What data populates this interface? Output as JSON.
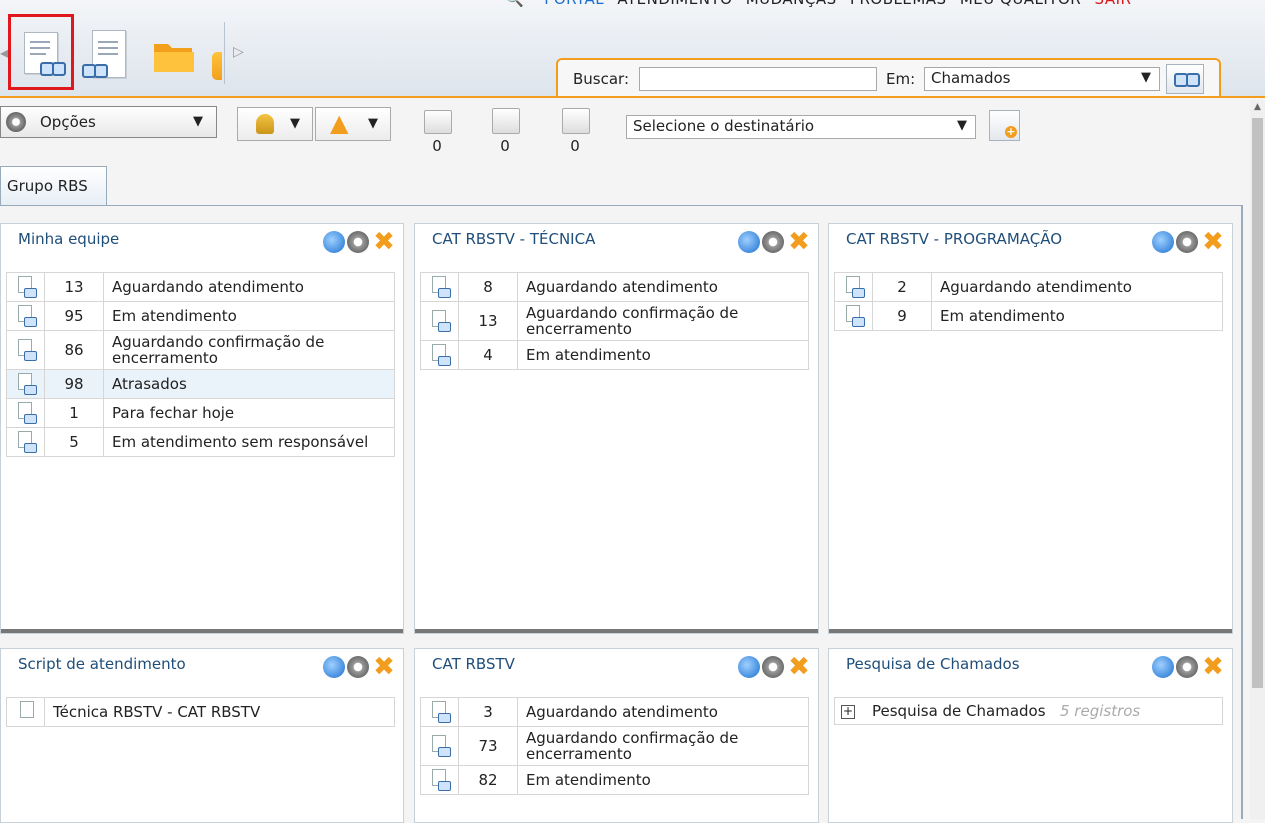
{
  "top_nav": {
    "portal": "PORTAL",
    "atendimento": "ATENDIMENTO",
    "mudancas": "MUDANÇAS",
    "problemas": "PROBLEMAS",
    "meu_qualitor": "MEU QUALITOR",
    "sair": "SAIR"
  },
  "search": {
    "label": "Buscar:",
    "value": "",
    "in_label": "Em:",
    "in_value": "Chamados"
  },
  "toolbar": {
    "options_label": "Opções",
    "counters": [
      "0",
      "0",
      "0"
    ],
    "recipient_placeholder": "Selecione o destinatário"
  },
  "tab": {
    "label": "Grupo RBS"
  },
  "panels": [
    {
      "title": "Minha equipe",
      "rows": [
        {
          "count": "13",
          "label": "Aguardando atendimento"
        },
        {
          "count": "95",
          "label": "Em atendimento"
        },
        {
          "count": "86",
          "label": "Aguardando confirmação de encerramento"
        },
        {
          "count": "98",
          "label": "Atrasados"
        },
        {
          "count": "1",
          "label": "Para fechar hoje"
        },
        {
          "count": "5",
          "label": "Em atendimento sem responsável"
        }
      ]
    },
    {
      "title": "CAT RBSTV - TÉCNICA",
      "rows": [
        {
          "count": "8",
          "label": "Aguardando atendimento"
        },
        {
          "count": "13",
          "label": "Aguardando confirmação de encerramento"
        },
        {
          "count": "4",
          "label": "Em atendimento"
        }
      ]
    },
    {
      "title": "CAT RBSTV - PROGRAMAÇÃO",
      "rows": [
        {
          "count": "2",
          "label": "Aguardando atendimento"
        },
        {
          "count": "9",
          "label": "Em atendimento"
        }
      ]
    },
    {
      "title": "Script de atendimento",
      "rows": [
        {
          "label": "Técnica RBSTV - CAT RBSTV"
        }
      ]
    },
    {
      "title": "CAT RBSTV",
      "rows": [
        {
          "count": "3",
          "label": "Aguardando atendimento"
        },
        {
          "count": "73",
          "label": "Aguardando confirmação de encerramento"
        },
        {
          "count": "82",
          "label": "Em atendimento"
        }
      ]
    },
    {
      "title": "Pesquisa de Chamados",
      "rows": [
        {
          "label": "Pesquisa de Chamados",
          "note": "5 registros"
        }
      ]
    }
  ]
}
